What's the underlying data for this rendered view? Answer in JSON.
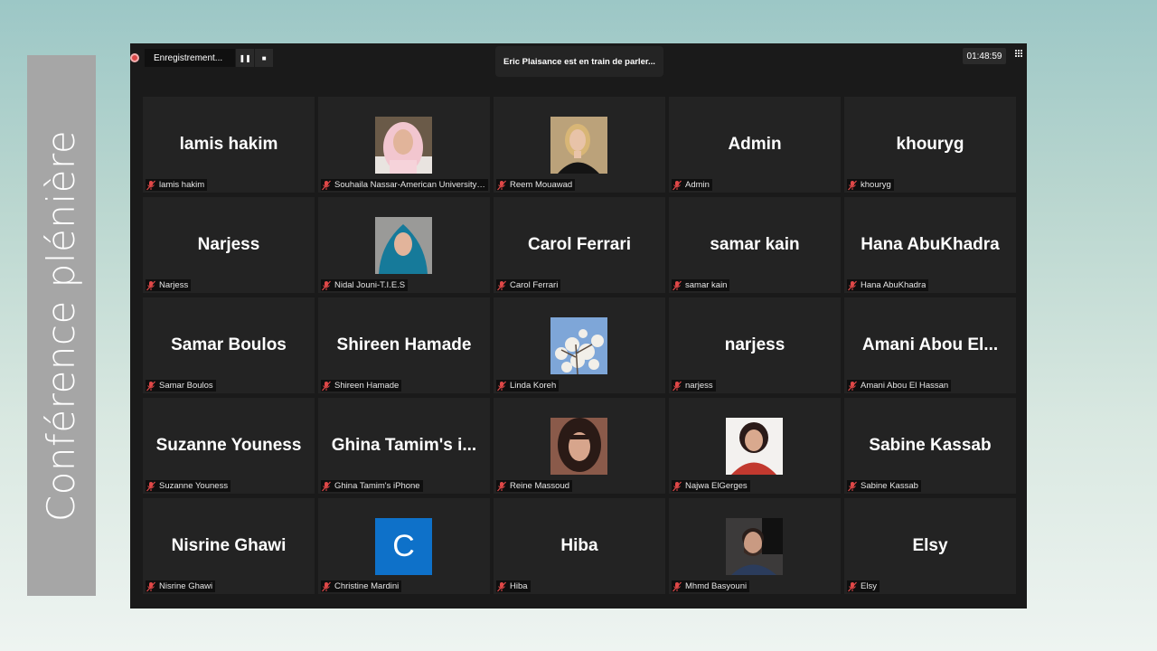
{
  "slide_title": "Conférence plénière",
  "recording": {
    "label": "Enregistrement...",
    "pause_symbol": "❚❚",
    "stop_symbol": "■"
  },
  "speaking": "Eric Plaisance est en train de parler...",
  "timer": "01:48:59",
  "colors": {
    "mute": "#e04848",
    "avatar_c": "#0e71c9",
    "tile_bg": "#232323"
  },
  "participants": [
    {
      "name": "lamis hakim",
      "label": "lamis hakim",
      "photo": null
    },
    {
      "name": "",
      "label": "Souhaila Nassar-American University o...",
      "photo": "woman-pink-hijab"
    },
    {
      "name": "",
      "label": "Reem Mouawad",
      "photo": "woman-blonde"
    },
    {
      "name": "Admin",
      "label": "Admin",
      "photo": null
    },
    {
      "name": "khouryg",
      "label": "khouryg",
      "photo": null
    },
    {
      "name": "Narjess",
      "label": "Narjess",
      "photo": null
    },
    {
      "name": "",
      "label": "Nidal Jouni-T.I.E.S",
      "photo": "woman-blue-hijab"
    },
    {
      "name": "Carol Ferrari",
      "label": "Carol Ferrari",
      "photo": null
    },
    {
      "name": "samar kain",
      "label": "samar kain",
      "photo": null
    },
    {
      "name": "Hana AbuKhadra",
      "label": "Hana AbuKhadra",
      "photo": null
    },
    {
      "name": "Samar Boulos",
      "label": "Samar Boulos",
      "photo": null
    },
    {
      "name": "Shireen Hamade",
      "label": "Shireen Hamade",
      "photo": null
    },
    {
      "name": "",
      "label": "Linda Koreh",
      "photo": "blossom-tree"
    },
    {
      "name": "narjess",
      "label": "narjess",
      "photo": null
    },
    {
      "name": "Amani Abou El...",
      "label": "Amani Abou El Hassan",
      "photo": null
    },
    {
      "name": "Suzanne Youness",
      "label": "Suzanne Youness",
      "photo": null
    },
    {
      "name": "Ghina Tamim's i...",
      "label": "Ghina Tamim's iPhone",
      "photo": null
    },
    {
      "name": "",
      "label": "Reine Massoud",
      "photo": "woman-dark-hair"
    },
    {
      "name": "",
      "label": "Najwa ElGerges",
      "photo": "woman-red-top"
    },
    {
      "name": "Sabine Kassab",
      "label": "Sabine Kassab",
      "photo": null
    },
    {
      "name": "Nisrine Ghawi",
      "label": "Nisrine Ghawi",
      "photo": null
    },
    {
      "name": "",
      "label": "Christine Mardini",
      "letter": "C"
    },
    {
      "name": "Hiba",
      "label": "Hiba",
      "photo": null
    },
    {
      "name": "",
      "label": "Mhmd Basyouni",
      "photo": "man-beard"
    },
    {
      "name": "Elsy",
      "label": "Elsy",
      "photo": null
    }
  ]
}
